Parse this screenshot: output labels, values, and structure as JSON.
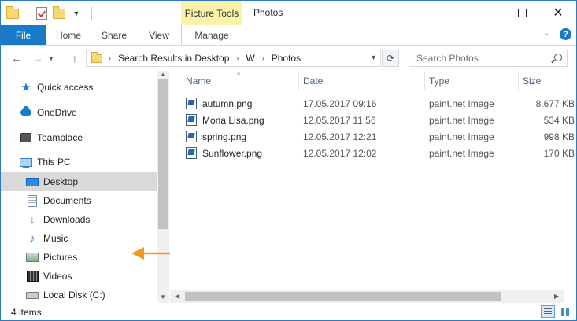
{
  "window": {
    "title": "Photos",
    "context_tab_group": "Picture Tools",
    "controls": {
      "minimize": "",
      "maximize": "",
      "close": "✕"
    }
  },
  "ribbon": {
    "tabs": [
      {
        "label": "File"
      },
      {
        "label": "Home"
      },
      {
        "label": "Share"
      },
      {
        "label": "View"
      },
      {
        "label": "Manage"
      }
    ],
    "help_label": "?"
  },
  "address": {
    "crumbs": [
      "Search Results in Desktop",
      "W",
      "Photos"
    ],
    "search_placeholder": "Search Photos"
  },
  "nav_pane": {
    "items": [
      {
        "label": "Quick access",
        "icon": "star-icon"
      },
      {
        "label": "OneDrive",
        "icon": "cloud-icon"
      },
      {
        "label": "Teamplace",
        "icon": "teamplace-icon"
      },
      {
        "label": "This PC",
        "icon": "computer-icon"
      },
      {
        "label": "Desktop",
        "icon": "desktop-icon",
        "selected": true
      },
      {
        "label": "Documents",
        "icon": "documents-icon"
      },
      {
        "label": "Downloads",
        "icon": "download-icon"
      },
      {
        "label": "Music",
        "icon": "music-icon"
      },
      {
        "label": "Pictures",
        "icon": "pictures-icon"
      },
      {
        "label": "Videos",
        "icon": "videos-icon"
      },
      {
        "label": "Local Disk (C:)",
        "icon": "disk-icon"
      }
    ]
  },
  "file_list": {
    "columns": [
      "Name",
      "Date",
      "Type",
      "Size"
    ],
    "rows": [
      {
        "name": "autumn.png",
        "date": "17.05.2017 09:16",
        "type": "paint.net Image",
        "size": "8.677 KB"
      },
      {
        "name": "Mona Lisa.png",
        "date": "12.05.2017 11:56",
        "type": "paint.net Image",
        "size": "534 KB"
      },
      {
        "name": "spring.png",
        "date": "12.05.2017 12:21",
        "type": "paint.net Image",
        "size": "998 KB"
      },
      {
        "name": "Sunflower.png",
        "date": "12.05.2017 12:02",
        "type": "paint.net Image",
        "size": "170 KB"
      }
    ]
  },
  "status": {
    "item_count": "4 items"
  },
  "colors": {
    "accent": "#1979ca",
    "context_tab": "#fdf2a9",
    "selection": "#d9d9d9",
    "arrow": "#f39a1e"
  }
}
